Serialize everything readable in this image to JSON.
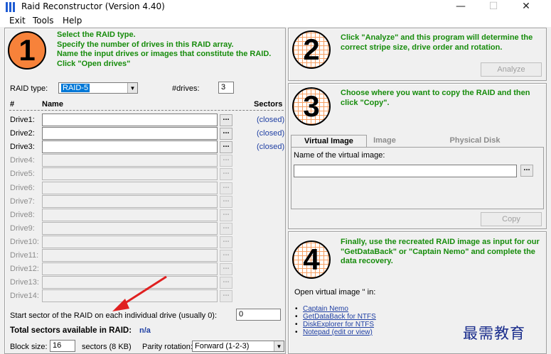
{
  "window": {
    "title": "Raid Reconstructor (Version 4.40)",
    "min_glyph": "—",
    "max_glyph": "☐",
    "close_glyph": "✕"
  },
  "menu": [
    "Exit",
    "Tools",
    "Help"
  ],
  "step1": {
    "number": "1",
    "instructions": [
      "Select the RAID type.",
      "Specify the number of drives in this RAID array.",
      "Name the input drives or images that constitute the RAID.",
      "Click \"Open drives\""
    ],
    "raid_type_label": "RAID type:",
    "raid_type_value": "RAID-5",
    "drives_label": "#drives:",
    "drives_value": "3",
    "col_hash": "#",
    "col_name": "Name",
    "col_sectors": "Sectors",
    "drives": [
      {
        "label": "Drive1:",
        "status": "(closed)",
        "enabled": true
      },
      {
        "label": "Drive2:",
        "status": "(closed)",
        "enabled": true
      },
      {
        "label": "Drive3:",
        "status": "(closed)",
        "enabled": true
      },
      {
        "label": "Drive4:",
        "status": "",
        "enabled": false
      },
      {
        "label": "Drive5:",
        "status": "",
        "enabled": false
      },
      {
        "label": "Drive6:",
        "status": "",
        "enabled": false
      },
      {
        "label": "Drive7:",
        "status": "",
        "enabled": false
      },
      {
        "label": "Drive8:",
        "status": "",
        "enabled": false
      },
      {
        "label": "Drive9:",
        "status": "",
        "enabled": false
      },
      {
        "label": "Drive10:",
        "status": "",
        "enabled": false
      },
      {
        "label": "Drive11:",
        "status": "",
        "enabled": false
      },
      {
        "label": "Drive12:",
        "status": "",
        "enabled": false
      },
      {
        "label": "Drive13:",
        "status": "",
        "enabled": false
      },
      {
        "label": "Drive14:",
        "status": "",
        "enabled": false
      }
    ],
    "browse_label": "...",
    "start_sector_label": "Start sector of the RAID on each individual drive (usually 0):",
    "start_sector_value": "0",
    "total_label": "Total sectors available in RAID:",
    "total_value": "n/a",
    "block_size_label": "Block size:",
    "block_size_value": "16",
    "block_size_unit": "sectors (8 KB)",
    "parity_label": "Parity rotation:",
    "parity_value": "Forward (1-2-3)"
  },
  "step2": {
    "number": "2",
    "instructions": "Click \"Analyze\" and this program will determine the correct stripe size, drive order and rotation.",
    "analyze_label": "Analyze"
  },
  "step3": {
    "number": "3",
    "instructions": "Choose where you want to copy the RAID and then click \"Copy\".",
    "tabs": [
      "Virtual Image",
      "Image",
      "Physical Disk"
    ],
    "image_name_label": "Name of the virtual image:",
    "image_name_value": "",
    "browse_label": "...",
    "copy_label": "Copy"
  },
  "step4": {
    "number": "4",
    "instructions": "Finally, use the recreated RAID image as input for our \"GetDataBack\" or \"Captain Nemo\" and complete the data recovery.",
    "open_label": "Open virtual image '' in:",
    "links": [
      "Captain Nemo",
      "GetDataBack for NTFS",
      "DiskExplorer for NTFS",
      "Notepad (edit or view)"
    ]
  },
  "watermark": "最需教育",
  "colors": {
    "instruction_green": "#178c0c",
    "circle_orange": "#f7823a",
    "selection_blue": "#0078d7",
    "link_blue": "#1f3fa3",
    "arrow_red": "#e02020"
  }
}
